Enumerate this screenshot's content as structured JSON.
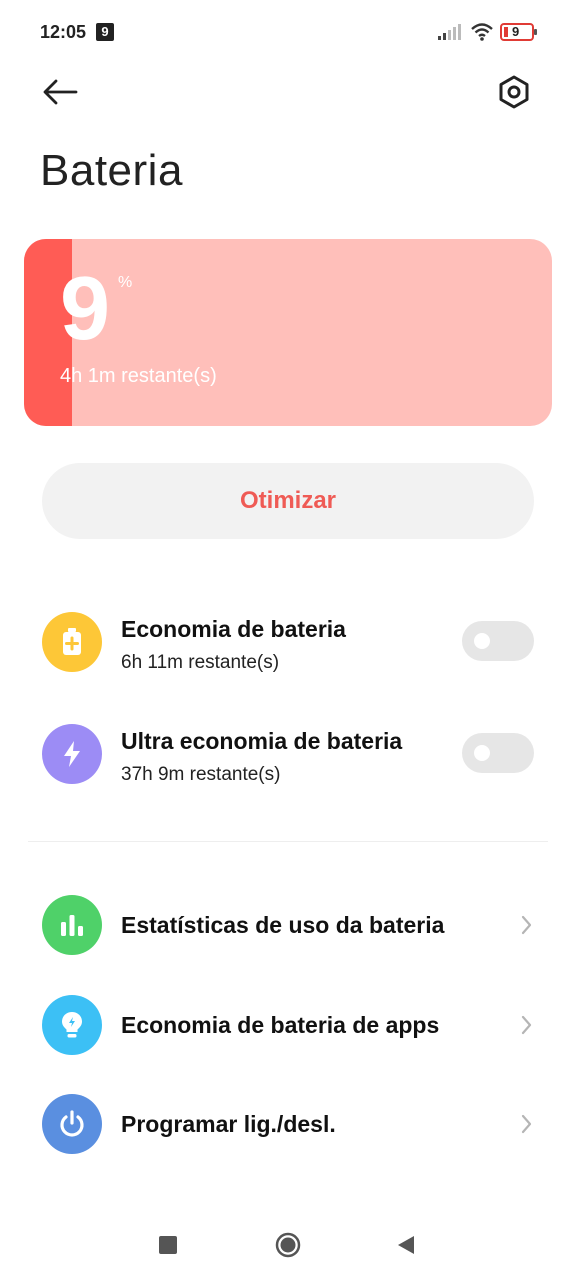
{
  "status_bar": {
    "time": "12:05",
    "notification_badge": "9",
    "battery_level": "9",
    "icons": [
      "signal-icon",
      "wifi-icon",
      "battery-icon"
    ]
  },
  "header": {
    "title": "Bateria",
    "back_icon": "arrow-left-icon",
    "settings_icon": "hexagon-settings-icon"
  },
  "battery": {
    "percent": "9",
    "percent_sign": "%",
    "level_fraction": 0.09,
    "remaining": "4h 1m restante(s)",
    "colors": {
      "card_bg": "#ffbfba",
      "fill": "#ff5c55"
    }
  },
  "optimize": {
    "label": "Otimizar",
    "color": "#ef5b55"
  },
  "saver_modes": [
    {
      "title": "Economia de bateria",
      "subtitle": "6h 11m restante(s)",
      "icon": "battery-plus-icon",
      "icon_color": "#fdc737",
      "enabled": false
    },
    {
      "title": "Ultra economia de bateria",
      "subtitle": "37h 9m restante(s)",
      "icon": "lightning-icon",
      "icon_color": "#9c8cf5",
      "enabled": false
    }
  ],
  "links": [
    {
      "title": "Estatísticas de uso da bateria",
      "icon": "bar-chart-icon",
      "icon_color": "#4fd169"
    },
    {
      "title": "Economia de bateria de apps",
      "icon": "lightbulb-icon",
      "icon_color": "#3cc0f5"
    },
    {
      "title": "Programar lig./desl.",
      "icon": "power-icon",
      "icon_color": "#5a8fe0"
    }
  ],
  "nav_bar": {
    "icons": [
      "recents-square-icon",
      "home-circle-icon",
      "back-triangle-icon"
    ]
  }
}
